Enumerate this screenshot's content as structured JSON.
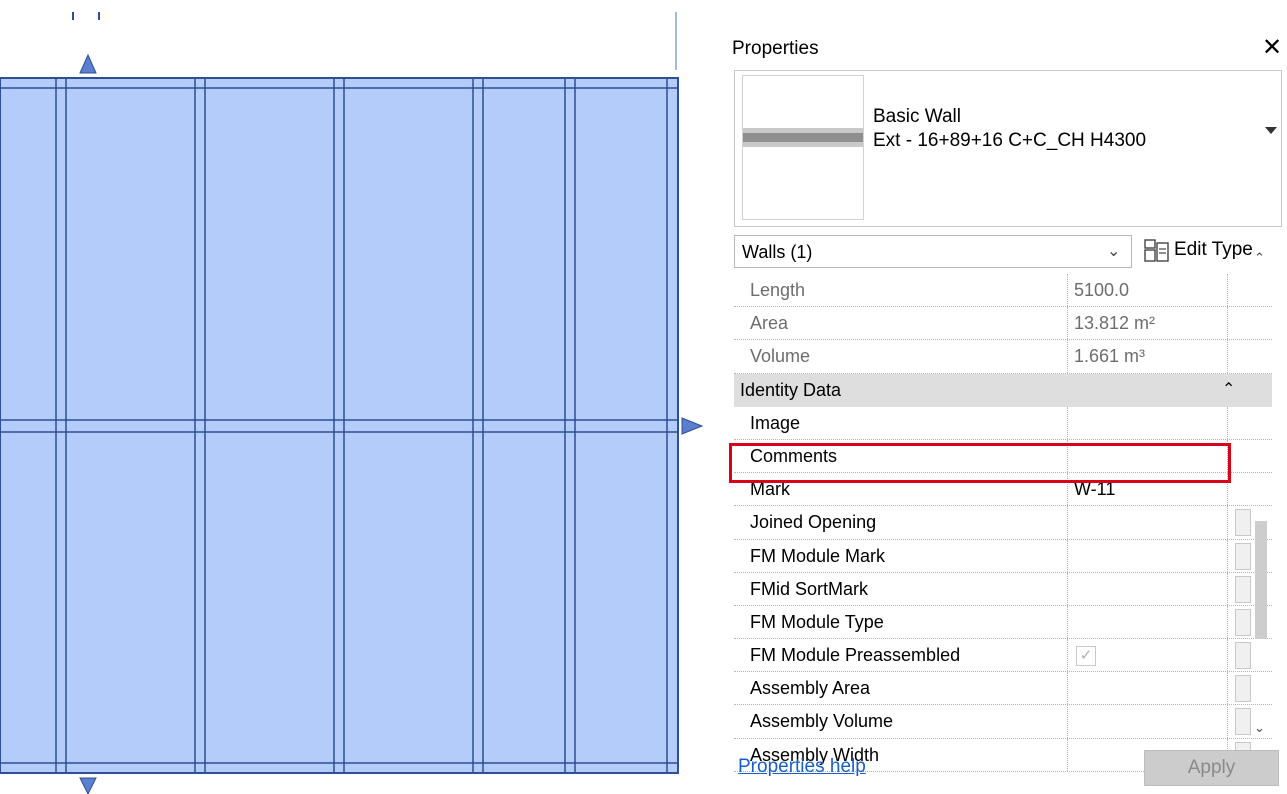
{
  "properties": {
    "title": "Properties",
    "close_glyph": "✕",
    "type_family": "Basic Wall",
    "type_name": "Ext - 16+89+16 C+C_CH H4300",
    "selector_label": "Walls (1)",
    "edit_type_label": "Edit Type",
    "help_link": "Properties help",
    "apply_label": "Apply",
    "rows": [
      {
        "name": "Length",
        "value": "5100.0"
      },
      {
        "name": "Area",
        "value": "13.812 m²"
      },
      {
        "name": "Volume",
        "value": "1.661 m³"
      },
      {
        "name": "Identity Data",
        "value": ""
      },
      {
        "name": "Image",
        "value": ""
      },
      {
        "name": "Comments",
        "value": ""
      },
      {
        "name": "Mark",
        "value": "W-11"
      },
      {
        "name": "Joined Opening",
        "value": ""
      },
      {
        "name": "FM Module Mark",
        "value": ""
      },
      {
        "name": "FMid SortMark",
        "value": ""
      },
      {
        "name": "FM Module Type",
        "value": ""
      },
      {
        "name": "FM Module Preassembled",
        "value": ""
      },
      {
        "name": "Assembly Area",
        "value": ""
      },
      {
        "name": "Assembly Volume",
        "value": ""
      },
      {
        "name": "Assembly Width",
        "value": ""
      }
    ],
    "preassembled_checked": true
  },
  "colors": {
    "wall_fill": "#b3ccfa",
    "wall_stroke": "#2e4f95",
    "highlight": "#d9001a",
    "link": "#1a5fc9"
  }
}
